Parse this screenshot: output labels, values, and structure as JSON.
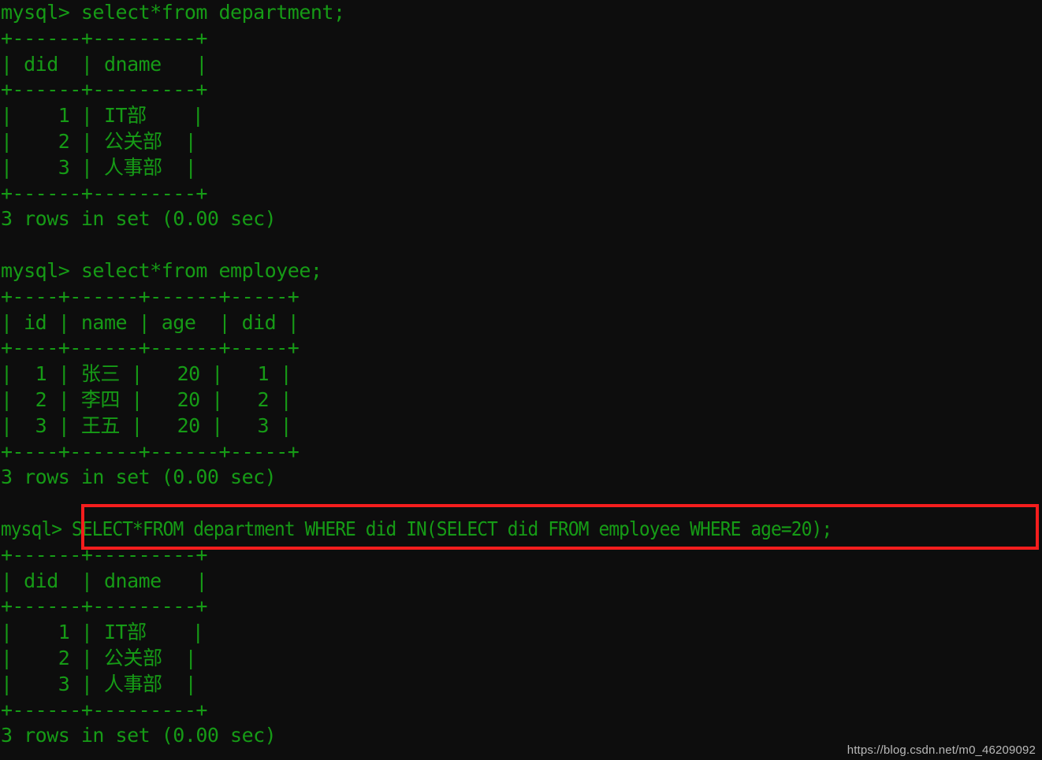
{
  "terminal": {
    "title": "mysql client console",
    "prompt": "mysql> ",
    "background_color": "#0d0d0d",
    "text_color": "#169b16",
    "highlight_color": "#f41d1d"
  },
  "lines": [
    {
      "id": "l01",
      "name": "command-select-department",
      "text": "mysql> select*from department;",
      "kind": "command"
    },
    {
      "id": "l02",
      "name": "table-border-top",
      "text": "+------+---------+",
      "kind": "border"
    },
    {
      "id": "l03",
      "name": "table-header-row",
      "text": "| did  | dname   |",
      "kind": "header"
    },
    {
      "id": "l04",
      "name": "table-border-mid",
      "text": "+------+---------+",
      "kind": "border"
    },
    {
      "id": "l05",
      "name": "table-data-row",
      "text": "|    1 | IT部    |",
      "kind": "data"
    },
    {
      "id": "l06",
      "name": "table-data-row",
      "text": "|    2 | 公关部  |",
      "kind": "data"
    },
    {
      "id": "l07",
      "name": "table-data-row",
      "text": "|    3 | 人事部  |",
      "kind": "data"
    },
    {
      "id": "l08",
      "name": "table-border-bottom",
      "text": "+------+---------+",
      "kind": "border"
    },
    {
      "id": "l09",
      "name": "result-status",
      "text": "3 rows in set (0.00 sec)",
      "kind": "status"
    },
    {
      "id": "l10",
      "name": "blank-line",
      "text": " ",
      "kind": "blank"
    },
    {
      "id": "l11",
      "name": "command-select-employee",
      "text": "mysql> select*from employee;",
      "kind": "command"
    },
    {
      "id": "l12",
      "name": "table-border-top",
      "text": "+----+------+------+-----+",
      "kind": "border"
    },
    {
      "id": "l13",
      "name": "table-header-row",
      "text": "| id | name | age  | did |",
      "kind": "header"
    },
    {
      "id": "l14",
      "name": "table-border-mid",
      "text": "+----+------+------+-----+",
      "kind": "border"
    },
    {
      "id": "l15",
      "name": "table-data-row",
      "text": "|  1 | 张三 |   20 |   1 |",
      "kind": "data"
    },
    {
      "id": "l16",
      "name": "table-data-row",
      "text": "|  2 | 李四 |   20 |   2 |",
      "kind": "data"
    },
    {
      "id": "l17",
      "name": "table-data-row",
      "text": "|  3 | 王五 |   20 |   3 |",
      "kind": "data"
    },
    {
      "id": "l18",
      "name": "table-border-bottom",
      "text": "+----+------+------+-----+",
      "kind": "border"
    },
    {
      "id": "l19",
      "name": "result-status",
      "text": "3 rows in set (0.00 sec)",
      "kind": "status"
    },
    {
      "id": "l20",
      "name": "blank-line",
      "text": " ",
      "kind": "blank"
    },
    {
      "id": "l21",
      "name": "command-subquery-highlighted",
      "text": "mysql> SELECT*FROM department WHERE did IN(SELECT did FROM employee WHERE age=20);",
      "kind": "query"
    },
    {
      "id": "l22",
      "name": "table-border-top",
      "text": "+------+---------+",
      "kind": "border"
    },
    {
      "id": "l23",
      "name": "table-header-row",
      "text": "| did  | dname   |",
      "kind": "header"
    },
    {
      "id": "l24",
      "name": "table-border-mid",
      "text": "+------+---------+",
      "kind": "border"
    },
    {
      "id": "l25",
      "name": "table-data-row",
      "text": "|    1 | IT部    |",
      "kind": "data"
    },
    {
      "id": "l26",
      "name": "table-data-row",
      "text": "|    2 | 公关部  |",
      "kind": "data"
    },
    {
      "id": "l27",
      "name": "table-data-row",
      "text": "|    3 | 人事部  |",
      "kind": "data"
    },
    {
      "id": "l28",
      "name": "table-border-bottom",
      "text": "+------+---------+",
      "kind": "border"
    },
    {
      "id": "l29",
      "name": "result-status",
      "text": "3 rows in set (0.00 sec)",
      "kind": "status"
    }
  ],
  "queries": {
    "first": "select*from department;",
    "second": "select*from employee;",
    "third": "SELECT*FROM department WHERE did IN(SELECT did FROM employee WHERE age=20);"
  },
  "tables": {
    "department": {
      "columns": [
        "did",
        "dname"
      ],
      "rows": [
        [
          "1",
          "IT部"
        ],
        [
          "2",
          "公关部"
        ],
        [
          "3",
          "人事部"
        ]
      ],
      "status": "3 rows in set (0.00 sec)"
    },
    "employee": {
      "columns": [
        "id",
        "name",
        "age",
        "did"
      ],
      "rows": [
        [
          "1",
          "张三",
          "20",
          "1"
        ],
        [
          "2",
          "李四",
          "20",
          "2"
        ],
        [
          "3",
          "王五",
          "20",
          "3"
        ]
      ],
      "status": "3 rows in set (0.00 sec)"
    },
    "subquery_result": {
      "columns": [
        "did",
        "dname"
      ],
      "rows": [
        [
          "1",
          "IT部"
        ],
        [
          "2",
          "公关部"
        ],
        [
          "3",
          "人事部"
        ]
      ],
      "status": "3 rows in set (0.00 sec)"
    }
  },
  "watermark": {
    "text": "https://blog.csdn.net/m0_46209092"
  }
}
